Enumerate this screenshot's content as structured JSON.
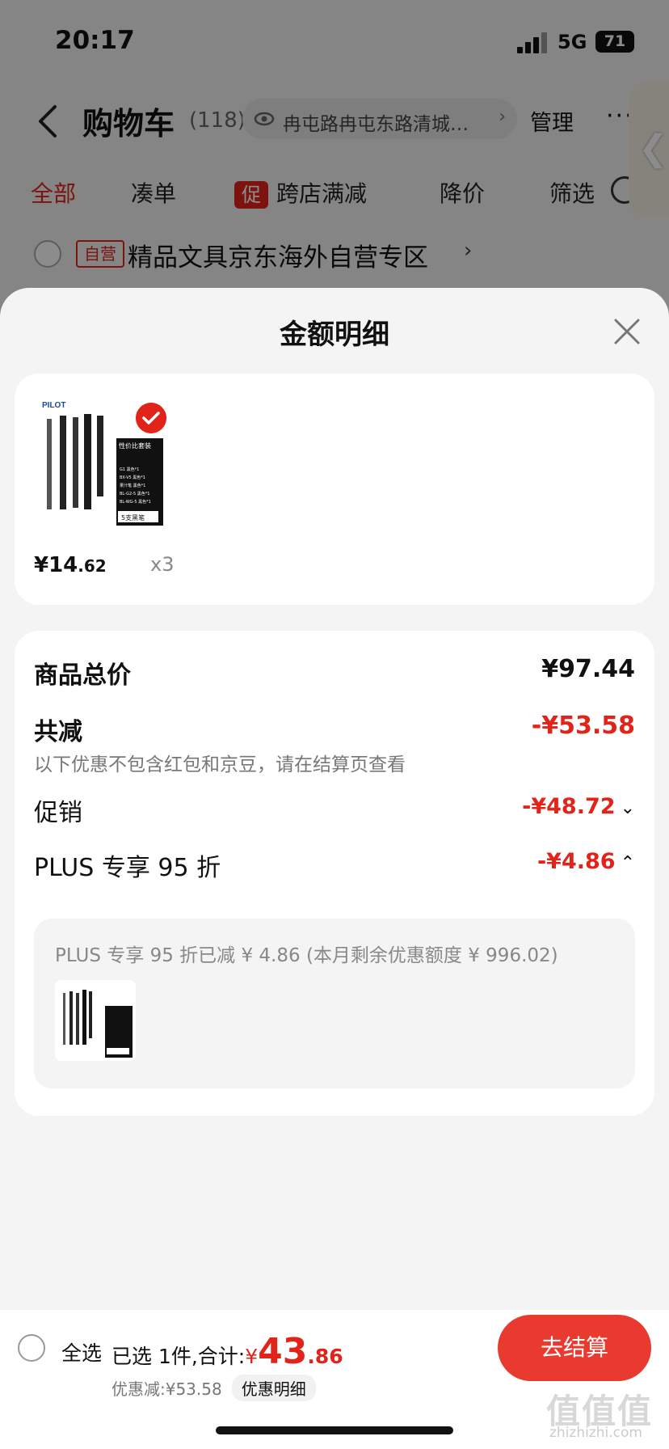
{
  "status_bar": {
    "time": "20:17",
    "network": "5G",
    "battery": "71"
  },
  "header": {
    "title": "购物车",
    "count": "(118)",
    "address": "冉屯路冉屯东路清城…",
    "manage": "管理",
    "more": "···"
  },
  "tabs": [
    {
      "label": "全部",
      "active": true
    },
    {
      "label": "凑单"
    },
    {
      "badge": "促",
      "label": "跨店满减"
    },
    {
      "label": "降价"
    },
    {
      "label": "筛选"
    }
  ],
  "store": {
    "tag": "自营",
    "name": "精品文具京东海外自营专区",
    "chevron": "›"
  },
  "sheet": {
    "title": "金额明细",
    "product": {
      "brand": "PILOT",
      "pack_title": "性价比套装",
      "pack_rows": [
        "G1 黑色*1",
        "BX-V5 黑色*1",
        "果汁笔 黑色*1",
        "BL-G2-5 黑色*1",
        "BL-WG-5 黑色*1"
      ],
      "pack_footer": "5支黑笔",
      "price_yen": "¥",
      "price_int": "14",
      "price_dec": ".62",
      "qty": "x3"
    },
    "details": {
      "total_label": "商品总价",
      "total_value": "¥97.44",
      "reduce_label": "共减",
      "reduce_value": "-¥53.58",
      "reduce_note": "以下优惠不包含红包和京豆，请在结算页查看",
      "promo_label": "促销",
      "promo_value": "-¥48.72",
      "plus_label": "PLUS 专享 95 折",
      "plus_value": "-¥4.86",
      "plus_note": "PLUS 专享 95 折已减 ¥ 4.86 (本月剩余优惠额度 ¥ 996.02)"
    }
  },
  "footer": {
    "select_all": "全选",
    "selected_text": "已选 1件,合计:",
    "total_yen": "¥",
    "total_int": "43",
    "total_dec": ".86",
    "discount_text": "优惠减:¥53.58",
    "discount_detail": "优惠明细",
    "checkout": "去结算"
  },
  "watermark": {
    "text": "值值值",
    "domain": "zhizhizhi.com"
  },
  "colors": {
    "accent": "#e2231a",
    "checkout": "#e83a2f"
  }
}
